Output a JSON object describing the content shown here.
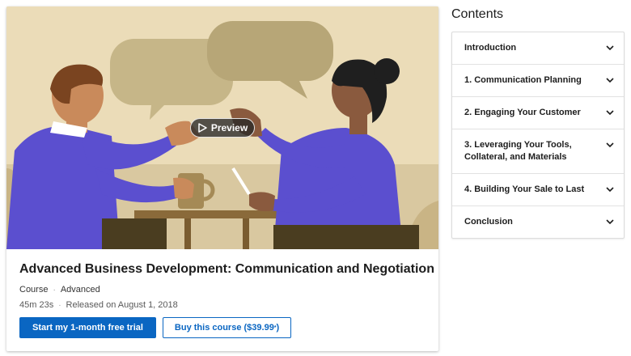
{
  "hero": {
    "preview_label": "Preview"
  },
  "course": {
    "title": "Advanced Business Development: Communication and Negotiation",
    "type": "Course",
    "level": "Advanced",
    "duration": "45m 23s",
    "released": "Released on August 1, 2018",
    "primary_cta": "Start my 1-month free trial",
    "buy_prefix": "Buy this course ($39.99",
    "buy_sup": "*",
    "buy_suffix": ")"
  },
  "contents": {
    "title": "Contents",
    "items": [
      {
        "label": "Introduction",
        "icon": "chevron-down-icon"
      },
      {
        "label": "1. Communication Planning",
        "icon": "chevron-down-icon"
      },
      {
        "label": "2. Engaging Your Customer",
        "icon": "chevron-down-icon"
      },
      {
        "label": "3. Leveraging Your Tools, Collateral, and Materials",
        "icon": "chevron-down-icon"
      },
      {
        "label": "4. Building Your Sale to Last",
        "icon": "chevron-down-icon"
      },
      {
        "label": "Conclusion",
        "icon": "chevron-down-icon"
      }
    ]
  },
  "colors": {
    "primary": "#0a66c2",
    "hero_background": "#ebdcb8",
    "shirt": "#5b4fcf"
  }
}
